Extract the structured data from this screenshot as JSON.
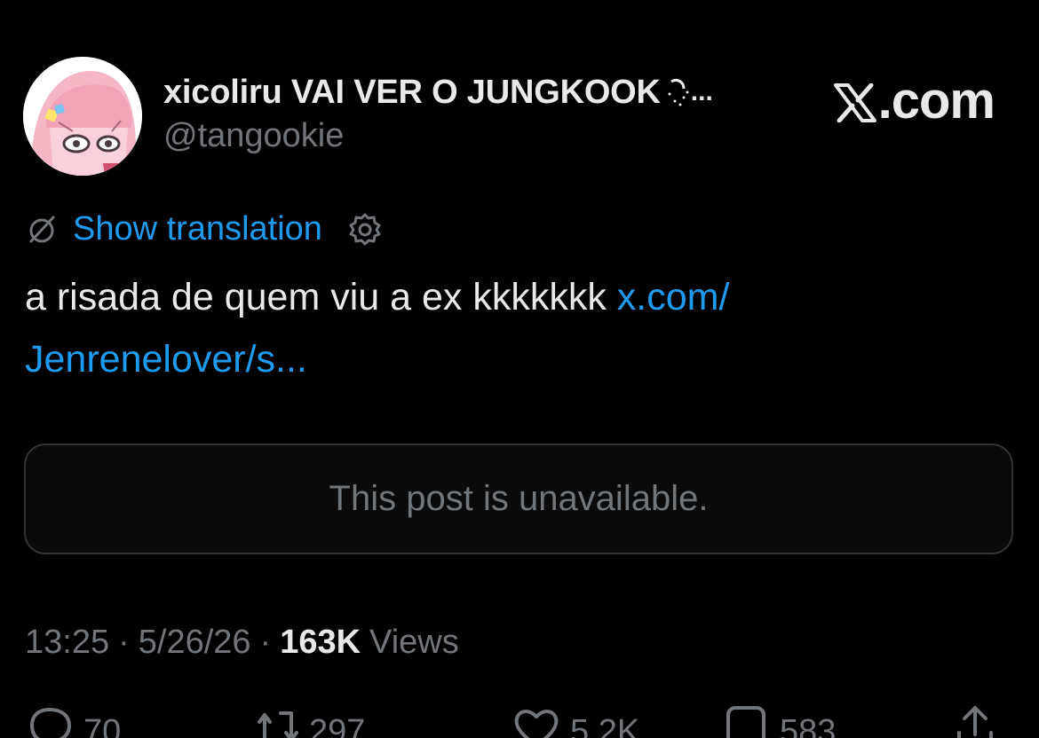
{
  "author": {
    "display_name": "xicoliru VAI VER O JUNGKOOK",
    "name_truncation": "...",
    "handle": "@tangookie",
    "avatar_icon": "anime-avatar-icon"
  },
  "brand": {
    "logo_icon": "x-logo-icon",
    "suffix": ".com"
  },
  "translation": {
    "icon": "translate-icon",
    "label": "Show translation",
    "settings_icon": "gear-icon"
  },
  "tweet": {
    "text": "a risada de quem viu a ex kkkkkkk ",
    "link_text": "x.com/ Jenrenelover/s..."
  },
  "quote": {
    "unavailable_text": "This post is unavailable."
  },
  "meta": {
    "time": "13:25",
    "separator": "·",
    "date": "5/26/26",
    "views_count": "163K",
    "views_label": "Views"
  },
  "actions": {
    "replies": "70",
    "reposts": "297",
    "likes": "5.2K",
    "bookmarks": "583"
  },
  "colors": {
    "background": "#000000",
    "text": "#e7e9ea",
    "muted": "#71767b",
    "link": "#1d9bf0",
    "border": "#2f3336"
  }
}
